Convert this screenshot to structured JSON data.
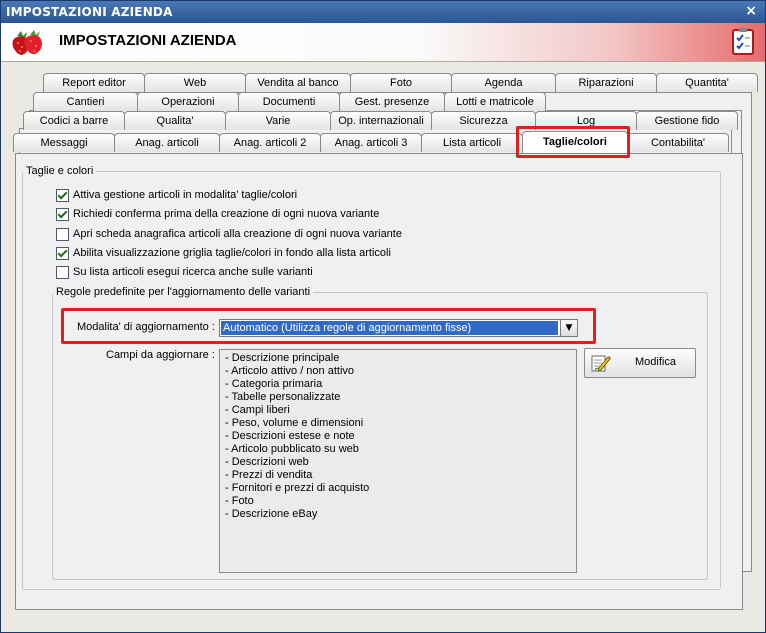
{
  "window": {
    "title": "IMPOSTAZIONI AZIENDA",
    "close_glyph": "×"
  },
  "header": {
    "title": "IMPOSTAZIONI AZIENDA",
    "logo_icon": "strawberries-icon",
    "right_icon": "checklist-icon"
  },
  "tabs": {
    "row1": [
      "Report editor",
      "Web",
      "Vendita al banco",
      "Foto",
      "Agenda",
      "Riparazioni",
      "Quantita'"
    ],
    "row2": [
      "Cantieri",
      "Operazioni",
      "Documenti",
      "Gest. presenze",
      "Lotti e matricole"
    ],
    "row3": [
      "Codici a barre",
      "Qualita'",
      "Varie",
      "Op. internazionali",
      "Sicurezza",
      "Log",
      "Gestione fido"
    ],
    "row4": [
      "Messaggi",
      "Anag. articoli",
      "Anag. articoli 2",
      "Anag. articoli 3",
      "Lista articoli",
      "Taglie/colori",
      "Contabilita'"
    ],
    "active": "Taglie/colori"
  },
  "group_main": {
    "title": "Taglie e colori",
    "checkboxes": [
      {
        "label": "Attiva gestione articoli in modalita' taglie/colori",
        "checked": true
      },
      {
        "label": "Richiedi conferma prima della creazione di ogni nuova variante",
        "checked": true
      },
      {
        "label": "Apri scheda anagrafica articoli alla creazione di ogni nuova variante",
        "checked": false
      },
      {
        "label": "Abilita visualizzazione griglia taglie/colori in fondo alla lista articoli",
        "checked": true
      },
      {
        "label": "Su lista articoli esegui ricerca anche sulle varianti",
        "checked": false
      }
    ]
  },
  "group_rules": {
    "title": "Regole predefinite per l'aggiornamento delle varianti",
    "mode_label": "Modalita' di aggiornamento :",
    "mode_value": "Automatico (Utilizza regole di aggiornamento fisse)",
    "fields_label": "Campi da aggiornare :",
    "fields": [
      "- Descrizione principale",
      "- Articolo attivo / non attivo",
      "- Categoria primaria",
      "- Tabelle personalizzate",
      "- Campi liberi",
      "- Peso, volume e dimensioni",
      "- Descrizioni estese e note",
      "- Articolo pubblicato su web",
      "- Descrizioni web",
      "- Prezzi di vendita",
      "- Fornitori e prezzi di acquisto",
      "- Foto",
      "- Descrizione eBay"
    ],
    "modify_button": "Modifica",
    "modify_icon": "edit-pencil-icon"
  },
  "colors": {
    "highlight": "#e02020",
    "selection": "#3169c6",
    "titlebar": "#2c5593"
  }
}
